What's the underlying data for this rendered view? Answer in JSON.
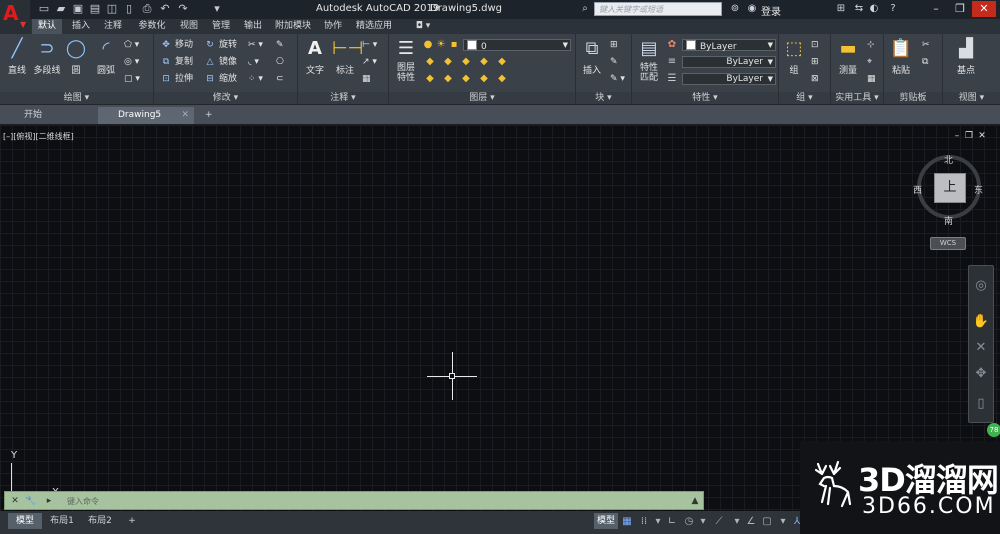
{
  "title_bar": {
    "app_title": "Autodesk AutoCAD 2019",
    "file_name": "Drawing5.dwg",
    "search_placeholder": "键入关键字或短语",
    "login_label": "登录",
    "help_label": "?"
  },
  "ribbon_tabs": [
    "默认",
    "插入",
    "注释",
    "参数化",
    "视图",
    "管理",
    "输出",
    "附加模块",
    "协作",
    "精选应用"
  ],
  "ribbon": {
    "draw": {
      "title": "绘图",
      "line": "直线",
      "polyline": "多段线",
      "circle": "圆",
      "arc": "圆弧"
    },
    "modify": {
      "title": "修改",
      "move": "移动",
      "rotate": "旋转",
      "copy": "复制",
      "mirror": "镜像",
      "stretch": "拉伸",
      "scale": "缩放"
    },
    "annotation": {
      "title": "注释",
      "text": "文字",
      "dimension": "标注"
    },
    "layers": {
      "title": "图层",
      "layer_properties": "图层\n特性",
      "layer_value": "0"
    },
    "block": {
      "title": "块",
      "insert": "插入"
    },
    "properties": {
      "title": "特性",
      "match": "特性\n匹配",
      "color": "ByLayer",
      "linetype": "ByLayer",
      "lineweight": "ByLayer"
    },
    "groups": {
      "title": "组",
      "group": "组"
    },
    "utilities": {
      "title": "实用工具",
      "measure": "测量"
    },
    "clipboard": {
      "title": "剪贴板",
      "paste": "粘贴"
    },
    "view": {
      "title": "视图",
      "base": "基点"
    }
  },
  "file_tabs": {
    "start": "开始",
    "drawing": "Drawing5"
  },
  "viewport": {
    "label": "[–][俯视][二维线框]",
    "viewcube": {
      "top": "上",
      "north": "北",
      "south": "南",
      "east": "东",
      "west": "西",
      "wcs": "WCS"
    },
    "ucs": {
      "x": "X",
      "y": "Y"
    }
  },
  "command_line": {
    "placeholder": "键入命令"
  },
  "layout_tabs": [
    "模型",
    "布局1",
    "布局2"
  ],
  "status_bar": {
    "model_label": "模型"
  },
  "watermark": {
    "big": "3D溜溜网",
    "small": "3D66.COM"
  },
  "badge": "78",
  "colors": {
    "accent": "#8fc3ff",
    "close": "#c42b1c",
    "cmdline": "#a6c29e",
    "logo_red": "#e01b1b"
  }
}
